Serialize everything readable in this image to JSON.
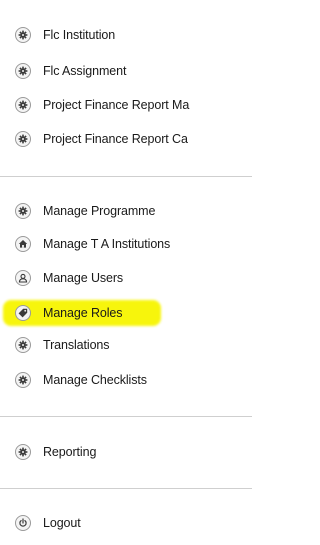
{
  "menu": {
    "section1": [
      {
        "label": "Flc Institution",
        "icon": "gear-icon"
      },
      {
        "label": "Flc Assignment",
        "icon": "gear-icon"
      },
      {
        "label": "Project Finance Report Ma",
        "icon": "gear-icon"
      },
      {
        "label": "Project Finance Report Ca",
        "icon": "gear-icon"
      }
    ],
    "section2": [
      {
        "label": "Manage Programme",
        "icon": "gear-icon"
      },
      {
        "label": "Manage T A Institutions",
        "icon": "home-icon"
      },
      {
        "label": "Manage Users",
        "icon": "user-icon"
      },
      {
        "label": "Manage Roles",
        "icon": "tag-icon",
        "highlighted": true
      },
      {
        "label": "Translations",
        "icon": "gear-icon"
      },
      {
        "label": "Manage Checklists",
        "icon": "gear-icon"
      }
    ],
    "section3": [
      {
        "label": "Reporting",
        "icon": "gear-icon"
      }
    ],
    "section4": [
      {
        "label": "Logout",
        "icon": "power-icon"
      }
    ]
  },
  "colors": {
    "highlight": "#f7f500",
    "divider": "#cfcfcf",
    "icon_border": "#9a9a9a",
    "icon_fill": "#3a3a3a",
    "text": "#1a1a1a"
  }
}
